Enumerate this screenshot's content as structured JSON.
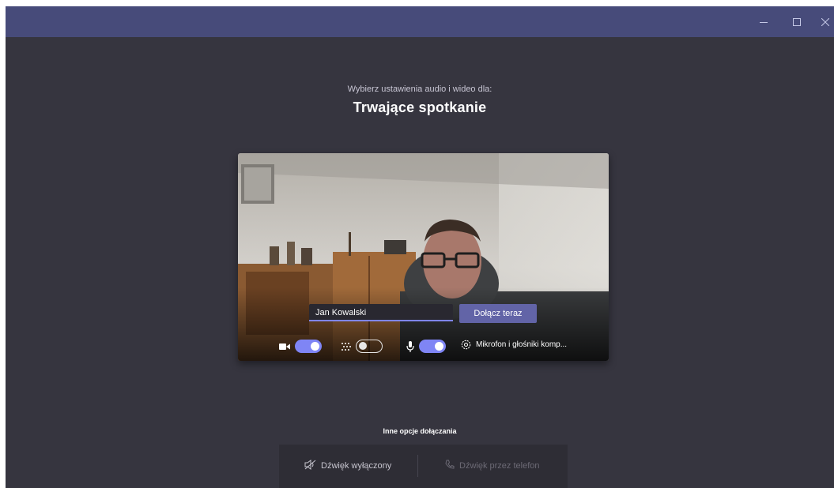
{
  "window": {
    "controls": {
      "minimize": "minimize-icon",
      "maximize": "maximize-icon",
      "close": "close-icon"
    }
  },
  "header": {
    "subtitle": "Wybierz ustawienia audio i wideo dla:",
    "title": "Trwające spotkanie"
  },
  "preview": {
    "name_value": "Jan Kowalski",
    "join_label": "Dołącz teraz",
    "camera": {
      "icon": "camera-icon",
      "on": true
    },
    "blur": {
      "icon": "background-blur-icon",
      "on": false
    },
    "mic": {
      "icon": "microphone-icon",
      "on": true
    },
    "device": {
      "icon": "gear-icon",
      "label": "Mikrofon i głośniki komp..."
    }
  },
  "other": {
    "heading": "Inne opcje dołączania",
    "audio_off": {
      "icon": "speaker-off-icon",
      "label": "Dźwięk wyłączony"
    },
    "phone_audio": {
      "icon": "phone-icon",
      "label": "Dźwięk przez telefon"
    }
  },
  "colors": {
    "titlebar": "#474b7a",
    "background": "#36353f",
    "accent": "#6264a7",
    "toggle_on": "#7f85f5"
  }
}
